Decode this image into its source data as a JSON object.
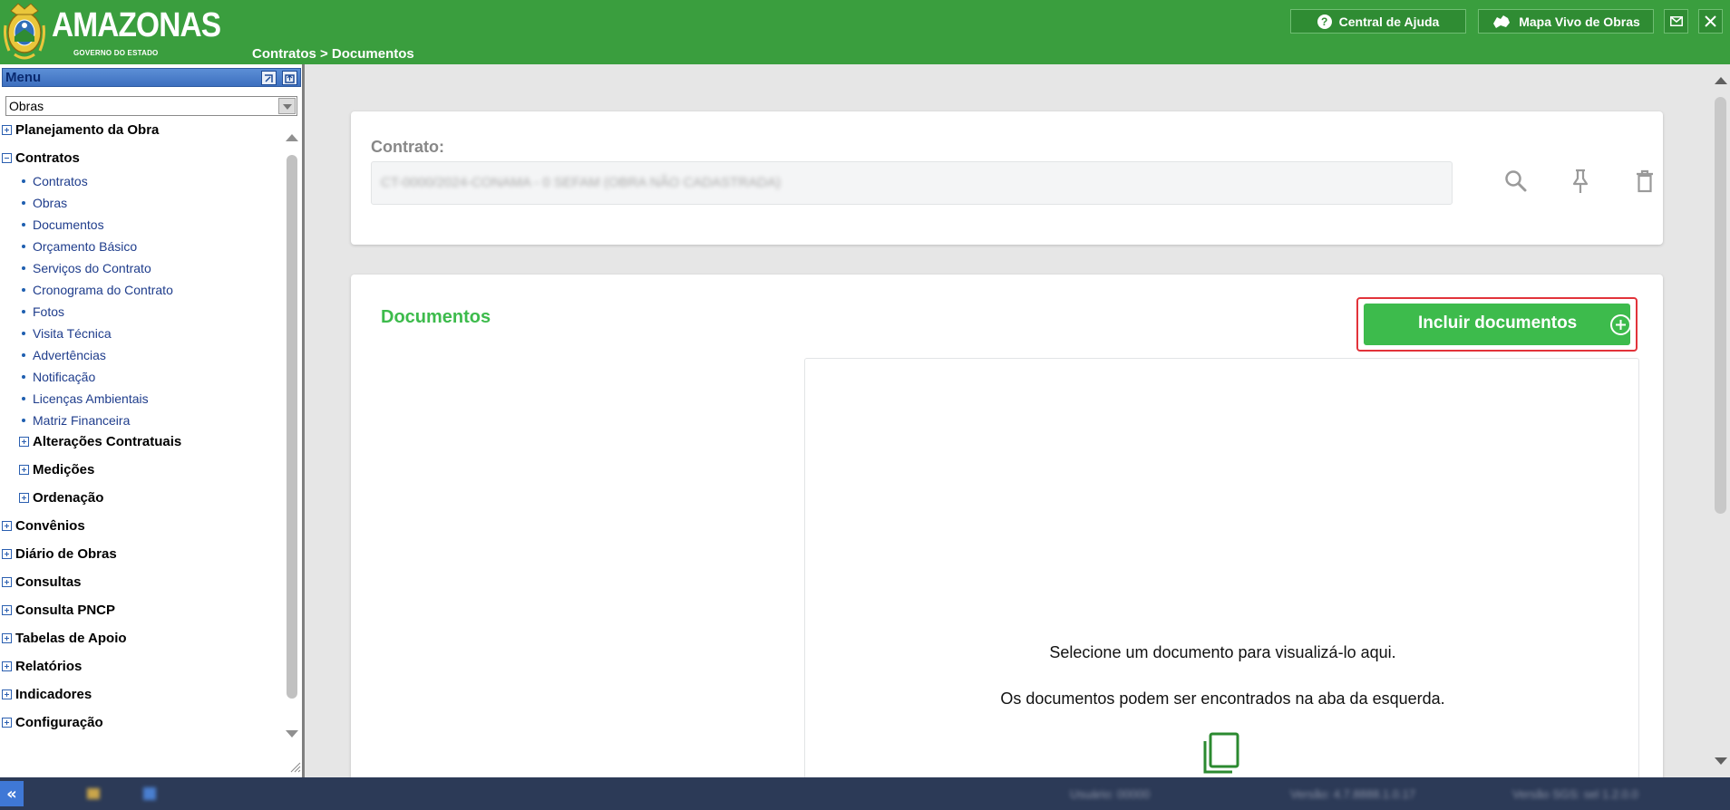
{
  "header": {
    "logo_title": "AMAZONAS",
    "logo_subtitle": "GOVERNO DO ESTADO",
    "breadcrumb": "Contratos > Documentos",
    "help_label": "Central de Ajuda",
    "map_label": "Mapa Vivo de Obras",
    "accent_color": "#3a9e3e"
  },
  "sidebar": {
    "title": "Menu",
    "module_selected": "Obras",
    "tree": [
      {
        "label": "Planejamento da Obra",
        "expanded": false
      },
      {
        "label": "Contratos",
        "expanded": true,
        "children": [
          {
            "label": "Contratos"
          },
          {
            "label": "Obras"
          },
          {
            "label": "Documentos"
          },
          {
            "label": "Orçamento Básico"
          },
          {
            "label": "Serviços do Contrato"
          },
          {
            "label": "Cronograma do Contrato"
          },
          {
            "label": "Fotos"
          },
          {
            "label": "Visita Técnica"
          },
          {
            "label": "Advertências"
          },
          {
            "label": "Notificação"
          },
          {
            "label": "Licenças Ambientais"
          },
          {
            "label": "Matriz Financeira"
          }
        ],
        "subgroups": [
          {
            "label": "Alterações Contratuais"
          },
          {
            "label": "Medições"
          },
          {
            "label": "Ordenação"
          }
        ]
      },
      {
        "label": "Convênios",
        "expanded": false
      },
      {
        "label": "Diário de Obras",
        "expanded": false
      },
      {
        "label": "Consultas",
        "expanded": false
      },
      {
        "label": "Consulta PNCP",
        "expanded": false
      },
      {
        "label": "Tabelas de Apoio",
        "expanded": false
      },
      {
        "label": "Relatórios",
        "expanded": false
      },
      {
        "label": "Indicadores",
        "expanded": false
      },
      {
        "label": "Configuração",
        "expanded": false
      }
    ]
  },
  "contrato": {
    "label": "Contrato:",
    "value": "CT-0000/2024-CONAMA - 0 SEFAM (OBRA NÃO CADASTRADA)"
  },
  "documentos": {
    "title": "Documentos",
    "include_button": "Incluir documentos",
    "empty_line1": "Selecione um documento para visualizá-lo aqui.",
    "empty_line2": "Os documentos podem ser encontrados na aba da esquerda.",
    "brand_green": "#3dbb4c"
  },
  "footer": {
    "user": "Usuário: 00000",
    "version1": "Versão: 4.7.8888.1.0.17",
    "version2": "Versão SGS: sel 1.2.0.0"
  }
}
